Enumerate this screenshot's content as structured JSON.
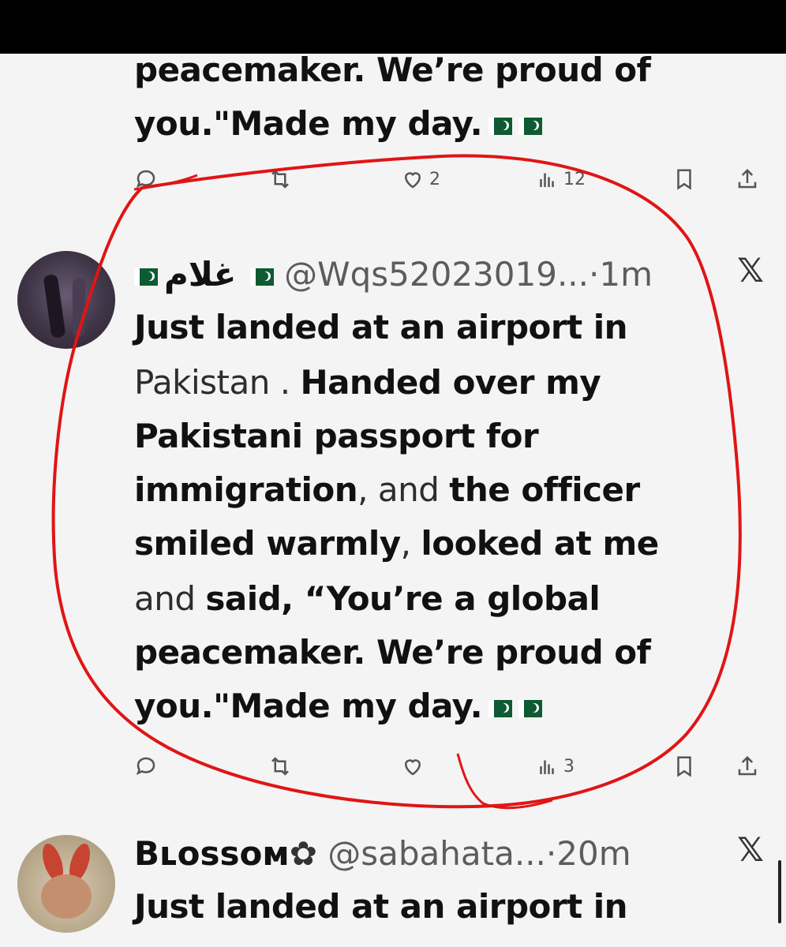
{
  "prev_tweet": {
    "line1": "peacemaker. We’re proud of",
    "line2": "you.\"Made my day.",
    "likes": "2",
    "views": "12"
  },
  "tweet": {
    "display_name": "غلام",
    "handle": "@Wqs52023019...",
    "sep": "·",
    "time": "1m",
    "text_lines": [
      {
        "bold": "Just landed at an airport in",
        "light": ""
      },
      {
        "bold": "",
        "light": "Pakistan . ",
        "bold2": "Handed over my"
      },
      {
        "bold": "Pakistani passport for",
        "light": ""
      },
      {
        "bold": "immigration",
        "light": ", and ",
        "bold2": "the officer"
      },
      {
        "bold": "smiled warmly",
        "light": ", ",
        "bold2": "looked at me"
      },
      {
        "bold": "",
        "light": "and ",
        "bold2": "said, “You’re a global"
      },
      {
        "bold": "peacemaker. We’re proud of",
        "light": ""
      },
      {
        "bold": "you.\"Made my day.",
        "light": ""
      }
    ],
    "views": "3"
  },
  "next_tweet": {
    "display_name": "Bʟossoм",
    "verified_icon": "gear-badge-icon",
    "handle": "@sabahata...",
    "sep": "·",
    "time": "20m",
    "line1": "Just landed at an airport in"
  },
  "icons": {
    "reply": "reply-icon",
    "retweet": "retweet-icon",
    "like": "heart-icon",
    "views": "views-icon",
    "bookmark": "bookmark-icon",
    "share": "share-icon",
    "close": "x-logo-icon"
  },
  "colors": {
    "annotation": "#e01515",
    "background": "#f4f4f4",
    "flag_green": "#0e5a32"
  }
}
